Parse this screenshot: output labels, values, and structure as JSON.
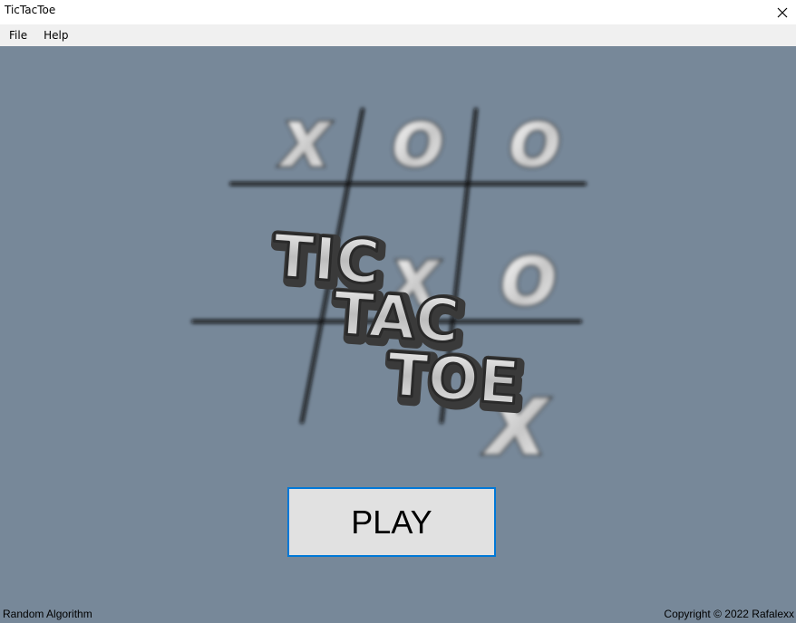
{
  "window": {
    "title": "TicTacToe",
    "close_icon": "close-icon"
  },
  "menu": {
    "items": [
      {
        "label": "File"
      },
      {
        "label": "Help"
      }
    ]
  },
  "logo": {
    "board_marks": [
      "X",
      "O",
      "O",
      "X",
      "O",
      "X"
    ],
    "title_lines": [
      "TIC",
      "TAC",
      "TOE"
    ]
  },
  "main": {
    "play_label": "PLAY"
  },
  "status": {
    "left": "Random Algorithm",
    "right": "Copyright © 2022 Rafalexx"
  },
  "colors": {
    "background": "#778899",
    "button_face": "#e1e1e1",
    "button_border": "#0078d7"
  }
}
